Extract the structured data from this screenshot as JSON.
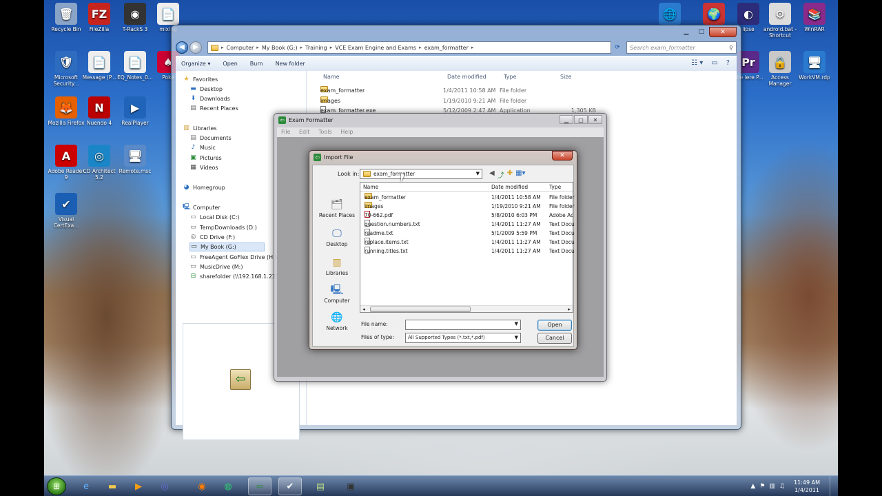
{
  "desktop": {
    "icons_left": [
      {
        "label": "Recycle Bin",
        "icon": "recycle-bin-icon",
        "glyph": "🗑",
        "color": "#8aa4c8"
      },
      {
        "label": "FileZilla",
        "icon": "filezilla-icon",
        "glyph": "FZ",
        "color": "#c8241e"
      },
      {
        "label": "T-RackS 3",
        "icon": "tracks-icon",
        "glyph": "◉",
        "color": "#333"
      },
      {
        "label": "mixing",
        "icon": "pdf-doc-icon",
        "glyph": "📄",
        "color": "#eee"
      },
      {
        "label": "Microsoft Security...",
        "icon": "security-essentials-icon",
        "glyph": "🛡",
        "color": "#2e6cc0"
      },
      {
        "label": "Message (P...",
        "icon": "document-icon",
        "glyph": "📄",
        "color": "#eee"
      },
      {
        "label": "EQ_Notes_0...",
        "icon": "pdf-doc-icon",
        "glyph": "📄",
        "color": "#eee"
      },
      {
        "label": "Poke",
        "icon": "poker-icon",
        "glyph": "♠",
        "color": "#c03"
      },
      {
        "label": "Mozilla Firefox",
        "icon": "firefox-icon",
        "glyph": "🦊",
        "color": "#e66000"
      },
      {
        "label": "Nuendo 4",
        "icon": "nuendo-icon",
        "glyph": "N",
        "color": "#b00"
      },
      {
        "label": "RealPlayer",
        "icon": "realplayer-icon",
        "glyph": "▶",
        "color": "#1f64b8"
      },
      {
        "label": "Adobe Reader 9",
        "icon": "adobe-reader-icon",
        "glyph": "A",
        "color": "#c00"
      },
      {
        "label": "CD Architect 5.2",
        "icon": "cd-architect-icon",
        "glyph": "◎",
        "color": "#1a86c7"
      },
      {
        "label": "Remote.msc",
        "icon": "remote-msc-icon",
        "glyph": "🖥",
        "color": "#5a8ac8"
      },
      {
        "label": "Visual CertExa...",
        "icon": "visual-certexam-icon",
        "glyph": "✔",
        "color": "#1b5fb5"
      }
    ],
    "icons_right": [
      {
        "label": "",
        "icon": "network-icon",
        "glyph": "🌐",
        "color": "#2a7bd0"
      },
      {
        "label": "",
        "icon": "globe-icon",
        "glyph": "🌍",
        "color": "#c33"
      },
      {
        "label": "lipse",
        "icon": "eclipse-icon",
        "glyph": "◐",
        "color": "#2c2c7a"
      },
      {
        "label": "android.bat - Shortcut",
        "icon": "batch-shortcut-icon",
        "glyph": "⚙",
        "color": "#ddd"
      },
      {
        "label": "WinRAR",
        "icon": "winrar-icon",
        "glyph": "📚",
        "color": "#8a2a8a"
      },
      {
        "label": "obe iere P...",
        "icon": "adobe-premiere-icon",
        "glyph": "Pr",
        "color": "#5a2a8a"
      },
      {
        "label": "Access Manager",
        "icon": "access-manager-icon",
        "glyph": "🔒",
        "color": "#c8c8c8"
      },
      {
        "label": "WorkVM.rdp",
        "icon": "rdp-icon",
        "glyph": "🖥",
        "color": "#2a7bd0"
      }
    ]
  },
  "explorer": {
    "breadcrumb": [
      "Computer",
      "My Book (G:)",
      "Training",
      "VCE Exam Engine and Exams",
      "exam_formatter"
    ],
    "search_placeholder": "Search exam_formatter",
    "toolbar": {
      "organize": "Organize ▾",
      "open": "Open",
      "burn": "Burn",
      "new_folder": "New folder"
    },
    "nav": {
      "favorites": "Favorites",
      "desktop": "Desktop",
      "downloads": "Downloads",
      "recent_places": "Recent Places",
      "libraries": "Libraries",
      "documents": "Documents",
      "music": "Music",
      "pictures": "Pictures",
      "videos": "Videos",
      "homegroup": "Homegroup",
      "computer": "Computer",
      "local_disk": "Local Disk (C:)",
      "temp_downloads": "TempDownloads (D:)",
      "cd_drive": "CD Drive (F:)",
      "my_book": "My Book (G:)",
      "freeagent": "FreeAgent GoFlex Drive (H:)",
      "music_drive": "MusicDrive (M:)",
      "sharefolder": "sharefolder (\\\\192.168.1.235) (Z:)"
    },
    "columns": {
      "name": "Name",
      "date": "Date modified",
      "type": "Type",
      "size": "Size"
    },
    "files": [
      {
        "name": "exam_formatter",
        "date": "1/4/2011 10:58 AM",
        "type": "File folder",
        "size": ""
      },
      {
        "name": "images",
        "date": "1/19/2010 9:21 AM",
        "type": "File folder",
        "size": ""
      },
      {
        "name": "exam_formatter.exe",
        "date": "5/12/2009 2:47 AM",
        "type": "Application",
        "size": "1,305 KB"
      }
    ]
  },
  "formatter": {
    "title": "Exam Formatter",
    "menu": [
      "File",
      "Edit",
      "Tools",
      "Help"
    ]
  },
  "dialog": {
    "title": "Import File",
    "look_in_label": "Look in:",
    "look_in_value": "exam_formatter",
    "places": [
      "Recent Places",
      "Desktop",
      "Libraries",
      "Computer",
      "Network"
    ],
    "columns": {
      "name": "Name",
      "date": "Date modified",
      "type": "Type"
    },
    "files": [
      {
        "name": "exam_formatter",
        "date": "1/4/2011 10:58 AM",
        "type": "File folder",
        "kind": "folder"
      },
      {
        "name": "images",
        "date": "1/19/2010 9:21 AM",
        "type": "File folder",
        "kind": "folder"
      },
      {
        "name": "70-662.pdf",
        "date": "5/8/2010 6:03 PM",
        "type": "Adobe Ac",
        "kind": "pdf"
      },
      {
        "name": "question.numbers.txt",
        "date": "1/4/2011 11:27 AM",
        "type": "Text Docu",
        "kind": "txt"
      },
      {
        "name": "readme.txt",
        "date": "5/1/2009 5:59 PM",
        "type": "Text Docu",
        "kind": "txt"
      },
      {
        "name": "replace.items.txt",
        "date": "1/4/2011 11:27 AM",
        "type": "Text Docu",
        "kind": "txt"
      },
      {
        "name": "running.titles.txt",
        "date": "1/4/2011 11:27 AM",
        "type": "Text Docu",
        "kind": "txt"
      }
    ],
    "file_name_label": "File name:",
    "file_name_value": "",
    "files_of_type_label": "Files of type:",
    "files_of_type_value": "All Supported Types (*.txt,*.pdf)",
    "open_label": "Open",
    "cancel_label": "Cancel"
  },
  "taskbar": {
    "time": "11:49 AM",
    "date": "1/4/2011"
  }
}
